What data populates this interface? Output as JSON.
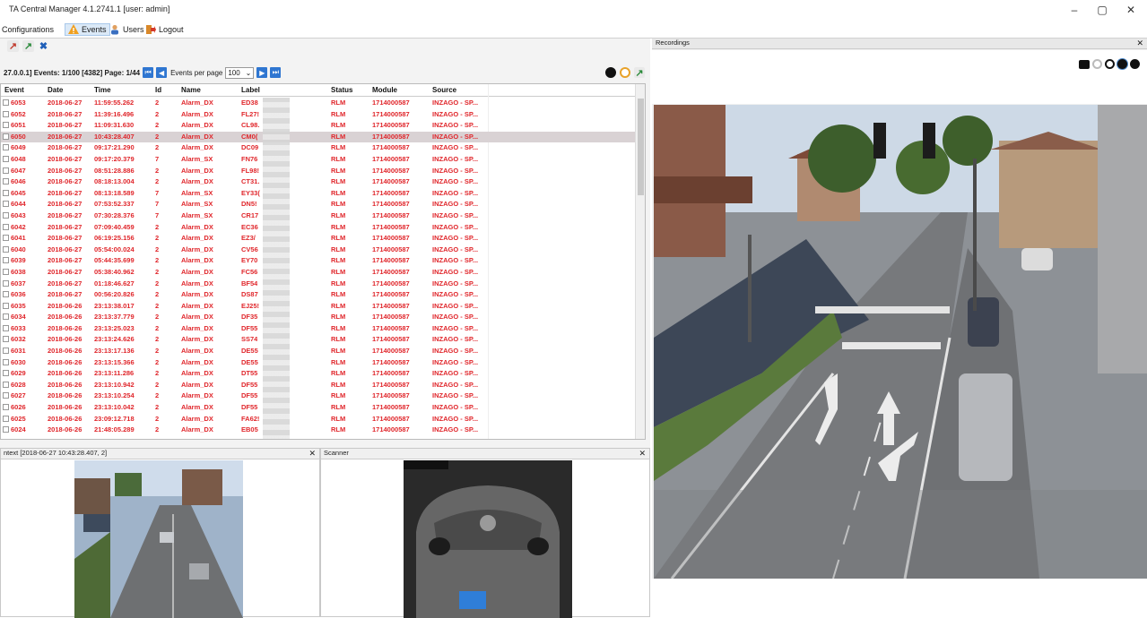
{
  "window": {
    "title": "TA Central Manager 4.1.2741.1 [user: admin]",
    "controls": [
      "–",
      "▢",
      "✕"
    ]
  },
  "menu": {
    "items": [
      {
        "label": "Configurations",
        "icon": "gear-icon"
      },
      {
        "label": "Events",
        "icon": "warning-icon"
      },
      {
        "label": "Users",
        "icon": "user-icon"
      },
      {
        "label": "Logout",
        "icon": "logout-icon"
      }
    ]
  },
  "events": {
    "info": "27.0.0.1] Events: 1/100 [4382] Page: 1/44",
    "per_page_label": "Events per page",
    "per_page_value": "100",
    "columns": [
      "Event",
      "Date",
      "Time",
      "Id",
      "Name",
      "Label",
      "Status",
      "Module",
      "Source"
    ],
    "rows": [
      [
        "6053",
        "2018-06-27",
        "11:59:55.262",
        "2",
        "Alarm_DX",
        "ED38",
        "RLM",
        "1714000587",
        "INZAGO - SP..."
      ],
      [
        "6052",
        "2018-06-27",
        "11:39:16.496",
        "2",
        "Alarm_DX",
        "FL27!",
        "RLM",
        "1714000587",
        "INZAGO - SP..."
      ],
      [
        "6051",
        "2018-06-27",
        "11:09:31.630",
        "2",
        "Alarm_DX",
        "CL98.",
        "RLM",
        "1714000587",
        "INZAGO - SP..."
      ],
      [
        "6050",
        "2018-06-27",
        "10:43:28.407",
        "2",
        "Alarm_DX",
        "CM0(",
        "RLM",
        "1714000587",
        "INZAGO - SP..."
      ],
      [
        "6049",
        "2018-06-27",
        "09:17:21.290",
        "2",
        "Alarm_DX",
        "DC09",
        "RLM",
        "1714000587",
        "INZAGO - SP..."
      ],
      [
        "6048",
        "2018-06-27",
        "09:17:20.379",
        "7",
        "Alarm_SX",
        "FN76",
        "RLM",
        "1714000587",
        "INZAGO - SP..."
      ],
      [
        "6047",
        "2018-06-27",
        "08:51:28.886",
        "2",
        "Alarm_DX",
        "FL98!",
        "RLM",
        "1714000587",
        "INZAGO - SP..."
      ],
      [
        "6046",
        "2018-06-27",
        "08:18:13.004",
        "2",
        "Alarm_DX",
        "CT31.",
        "RLM",
        "1714000587",
        "INZAGO - SP..."
      ],
      [
        "6045",
        "2018-06-27",
        "08:13:18.589",
        "7",
        "Alarm_SX",
        "EY33(",
        "RLM",
        "1714000587",
        "INZAGO - SP..."
      ],
      [
        "6044",
        "2018-06-27",
        "07:53:52.337",
        "7",
        "Alarm_SX",
        "DN5!",
        "RLM",
        "1714000587",
        "INZAGO - SP..."
      ],
      [
        "6043",
        "2018-06-27",
        "07:30:28.376",
        "7",
        "Alarm_SX",
        "CR17",
        "RLM",
        "1714000587",
        "INZAGO - SP..."
      ],
      [
        "6042",
        "2018-06-27",
        "07:09:40.459",
        "2",
        "Alarm_DX",
        "EC36",
        "RLM",
        "1714000587",
        "INZAGO - SP..."
      ],
      [
        "6041",
        "2018-06-27",
        "06:19:25.156",
        "2",
        "Alarm_DX",
        "EZ3/",
        "RLM",
        "1714000587",
        "INZAGO - SP..."
      ],
      [
        "6040",
        "2018-06-27",
        "05:54:00.024",
        "2",
        "Alarm_DX",
        "CV56",
        "RLM",
        "1714000587",
        "INZAGO - SP..."
      ],
      [
        "6039",
        "2018-06-27",
        "05:44:35.699",
        "2",
        "Alarm_DX",
        "EY70",
        "RLM",
        "1714000587",
        "INZAGO - SP..."
      ],
      [
        "6038",
        "2018-06-27",
        "05:38:40.962",
        "2",
        "Alarm_DX",
        "FC56",
        "RLM",
        "1714000587",
        "INZAGO - SP..."
      ],
      [
        "6037",
        "2018-06-27",
        "01:18:46.627",
        "2",
        "Alarm_DX",
        "BF54",
        "RLM",
        "1714000587",
        "INZAGO - SP..."
      ],
      [
        "6036",
        "2018-06-27",
        "00:56:20.826",
        "2",
        "Alarm_DX",
        "DS87",
        "RLM",
        "1714000587",
        "INZAGO - SP..."
      ],
      [
        "6035",
        "2018-06-26",
        "23:13:38.017",
        "2",
        "Alarm_DX",
        "EJ25!",
        "RLM",
        "1714000587",
        "INZAGO - SP..."
      ],
      [
        "6034",
        "2018-06-26",
        "23:13:37.779",
        "2",
        "Alarm_DX",
        "DF35",
        "RLM",
        "1714000587",
        "INZAGO - SP..."
      ],
      [
        "6033",
        "2018-06-26",
        "23:13:25.023",
        "2",
        "Alarm_DX",
        "DF55",
        "RLM",
        "1714000587",
        "INZAGO - SP..."
      ],
      [
        "6032",
        "2018-06-26",
        "23:13:24.626",
        "2",
        "Alarm_DX",
        "SS74",
        "RLM",
        "1714000587",
        "INZAGO - SP..."
      ],
      [
        "6031",
        "2018-06-26",
        "23:13:17.136",
        "2",
        "Alarm_DX",
        "DE55",
        "RLM",
        "1714000587",
        "INZAGO - SP..."
      ],
      [
        "6030",
        "2018-06-26",
        "23:13:15.366",
        "2",
        "Alarm_DX",
        "DE55",
        "RLM",
        "1714000587",
        "INZAGO - SP..."
      ],
      [
        "6029",
        "2018-06-26",
        "23:13:11.286",
        "2",
        "Alarm_DX",
        "DT55",
        "RLM",
        "1714000587",
        "INZAGO - SP..."
      ],
      [
        "6028",
        "2018-06-26",
        "23:13:10.942",
        "2",
        "Alarm_DX",
        "DF55",
        "RLM",
        "1714000587",
        "INZAGO - SP..."
      ],
      [
        "6027",
        "2018-06-26",
        "23:13:10.254",
        "2",
        "Alarm_DX",
        "DF55",
        "RLM",
        "1714000587",
        "INZAGO - SP..."
      ],
      [
        "6026",
        "2018-06-26",
        "23:13:10.042",
        "2",
        "Alarm_DX",
        "DF55",
        "RLM",
        "1714000587",
        "INZAGO - SP..."
      ],
      [
        "6025",
        "2018-06-26",
        "23:09:12.718",
        "2",
        "Alarm_DX",
        "FA62!",
        "RLM",
        "1714000587",
        "INZAGO - SP..."
      ],
      [
        "6024",
        "2018-06-26",
        "21:48:05.289",
        "2",
        "Alarm_DX",
        "EB05",
        "RLM",
        "1714000587",
        "INZAGO - SP..."
      ]
    ],
    "selected_index": 3
  },
  "panes": {
    "context_title": "ntext [2018-06-27 10:43:28.407, 2]",
    "scanner_title": "Scanner",
    "recordings_title": "Recordings"
  },
  "colors": {
    "row_text": "#e0262b",
    "selected_row": "#d9d2d4",
    "accent": "#2f76d1"
  }
}
